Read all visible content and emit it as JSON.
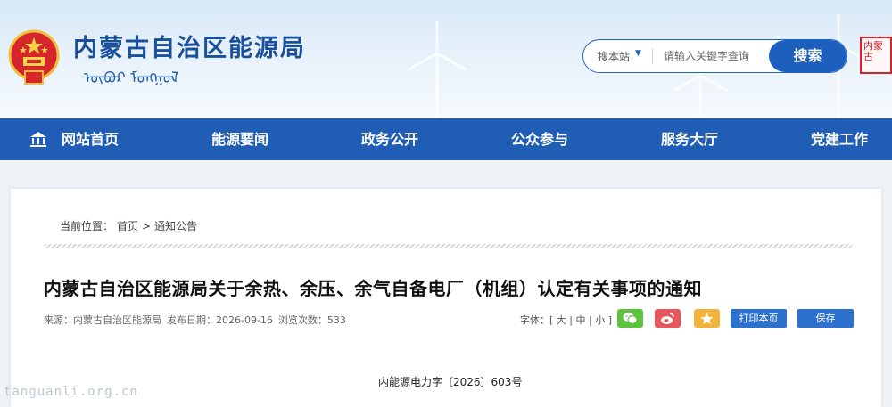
{
  "header": {
    "title": "内蒙古自治区能源局",
    "subtitle_mongolian": "ᠥᠪᠦᠷ ᠮᠣᠩᠭᠣᠯ",
    "seal_text": "内蒙古"
  },
  "search": {
    "scope": "搜本站",
    "placeholder": "请输入关键字查询",
    "button": "搜索"
  },
  "nav": {
    "items": [
      {
        "label": "网站首页"
      },
      {
        "label": "能源要闻"
      },
      {
        "label": "政务公开"
      },
      {
        "label": "公众参与"
      },
      {
        "label": "服务大厅"
      },
      {
        "label": "党建工作"
      }
    ]
  },
  "breadcrumb": {
    "prefix": "当前位置：",
    "home": "首页",
    "sep": ">",
    "current": "通知公告"
  },
  "article": {
    "title": "内蒙古自治区能源局关于余热、余压、余气自备电厂（机组）认定有关事项的通知",
    "source": "来源：内蒙古自治区能源局",
    "date": "发布日期：2026-09-16",
    "views": "浏览次数：533",
    "doc_number": "内能源电力字〔2026〕603号"
  },
  "font_size": {
    "label": "字体：",
    "open": "[",
    "large": "大",
    "medium": "中",
    "small": "小",
    "close": "]",
    "bar": "|"
  },
  "actions": {
    "print": "打印本页",
    "save": "保存"
  },
  "share": {
    "wechat_color": "#5fc23f",
    "weibo_color": "#e8555a",
    "favorite_color": "#f3b23a"
  },
  "watermark": "tanguanli.org.cn"
}
